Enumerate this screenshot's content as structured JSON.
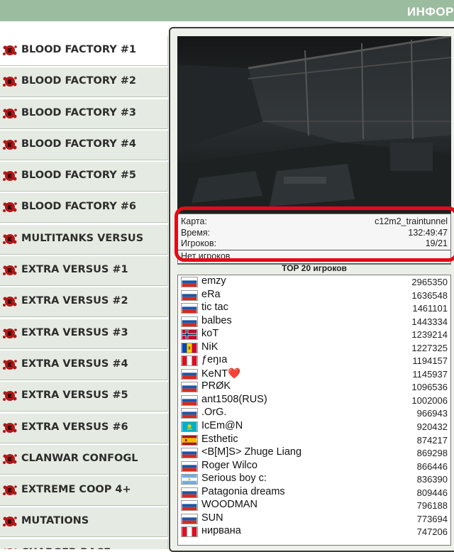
{
  "header": {
    "title": "ИНФОР"
  },
  "colors": {
    "header_bg": "#9cbca0",
    "highlight": "#e30a17",
    "menu_bg": "#e5ebe2",
    "menu_active_bg": "#ffffff"
  },
  "sidebar": {
    "items": [
      {
        "label": "BLOOD FACTORY #1",
        "active": true,
        "icon": "blood-splatter-icon"
      },
      {
        "label": "BLOOD FACTORY #2",
        "icon": "blood-splatter-icon"
      },
      {
        "label": "BLOOD FACTORY #3",
        "icon": "blood-splatter-icon"
      },
      {
        "label": "BLOOD FACTORY #4",
        "icon": "blood-splatter-icon"
      },
      {
        "label": "BLOOD FACTORY #5",
        "icon": "blood-splatter-icon"
      },
      {
        "label": "BLOOD FACTORY #6",
        "icon": "blood-splatter-icon"
      },
      {
        "label": "MULTITANKS VERSUS",
        "icon": "blood-splatter-icon"
      },
      {
        "label": "EXTRA VERSUS #1",
        "icon": "blood-splatter-icon"
      },
      {
        "label": "EXTRA VERSUS #2",
        "icon": "blood-splatter-icon"
      },
      {
        "label": "EXTRA VERSUS #3",
        "icon": "blood-splatter-icon"
      },
      {
        "label": "EXTRA VERSUS #4",
        "icon": "blood-splatter-icon"
      },
      {
        "label": "EXTRA VERSUS #5",
        "icon": "blood-splatter-icon"
      },
      {
        "label": "EXTRA VERSUS #6",
        "icon": "blood-splatter-icon"
      },
      {
        "label": "CLANWAR CONFOGL",
        "icon": "blood-splatter-icon"
      },
      {
        "label": "EXTREME COOP 4+",
        "icon": "blood-splatter-icon"
      },
      {
        "label": "MUTATIONS",
        "icon": "blood-splatter-icon"
      },
      {
        "label": "CHARGER RACE",
        "icon": "blood-splatter-icon"
      }
    ]
  },
  "server": {
    "map_label": "Карта:",
    "map_value": "c12m2_traintunnel",
    "time_label": "Время:",
    "time_value": "132:49:47",
    "players_label": "Игроков:",
    "players_value": "19/21",
    "no_players": "Нет игроков"
  },
  "top": {
    "header": "TOP 20 игроков",
    "players": [
      {
        "name": "emzy",
        "score": "2965350",
        "flag": "ru"
      },
      {
        "name": "eRa",
        "score": "1636548",
        "flag": "ru"
      },
      {
        "name": "tic tac",
        "score": "1461101",
        "flag": "ru"
      },
      {
        "name": "balbes",
        "score": "1443334",
        "flag": "ru"
      },
      {
        "name": "koT",
        "score": "1239214",
        "flag": "no"
      },
      {
        "name": "NiK",
        "score": "1227325",
        "flag": "md"
      },
      {
        "name": "ƒeŋıa",
        "score": "1194157",
        "flag": "pe"
      },
      {
        "name": "KeNT❤️",
        "score": "1145937",
        "flag": "ru"
      },
      {
        "name": "PRØK",
        "score": "1096536",
        "flag": "ru"
      },
      {
        "name": "ant1508(RUS)",
        "score": "1002006",
        "flag": "ru"
      },
      {
        "name": ".OrG.",
        "score": "966943",
        "flag": "ru"
      },
      {
        "name": "IcEm@N",
        "score": "920432",
        "flag": "kz"
      },
      {
        "name": "Esthetic",
        "score": "874217",
        "flag": "es"
      },
      {
        "name": "<B[M]S> Zhuge Liang",
        "score": "869298",
        "flag": "ru"
      },
      {
        "name": "Roger Wilco",
        "score": "866446",
        "flag": "ru"
      },
      {
        "name": "Serious boy c:",
        "score": "836390",
        "flag": "ar"
      },
      {
        "name": "Patagonia dreams",
        "score": "809446",
        "flag": "ru"
      },
      {
        "name": "WOODMAN",
        "score": "796188",
        "flag": "ru"
      },
      {
        "name": "SUN",
        "score": "773694",
        "flag": "ru"
      },
      {
        "name": "нирвана",
        "score": "747206",
        "flag": "pe"
      }
    ]
  }
}
